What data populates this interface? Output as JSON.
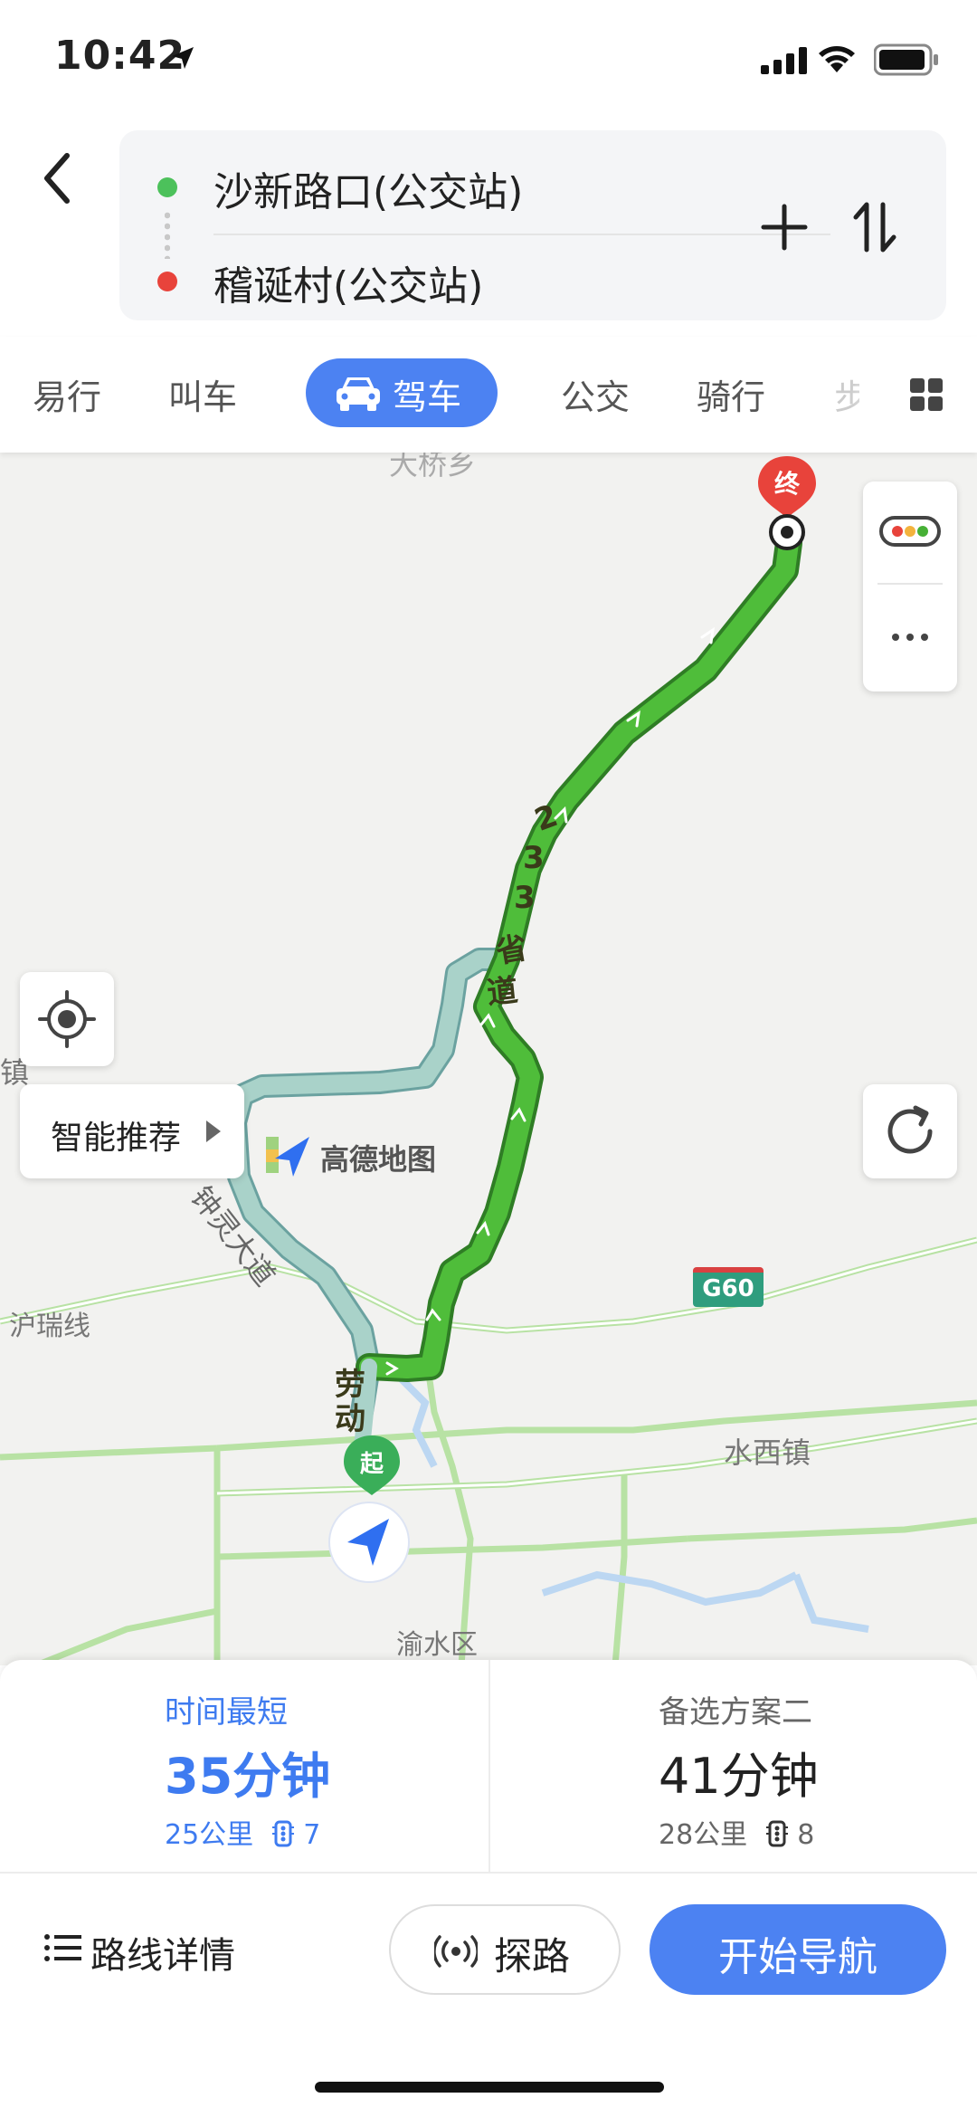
{
  "status_bar": {
    "time": "10:42"
  },
  "route": {
    "start": "沙新路口(公交站)",
    "end": "稽诞村(公交站)"
  },
  "tabs": {
    "easy": "易行",
    "taxi": "叫车",
    "drive": "驾车",
    "bus": "公交",
    "bike": "骑行",
    "walk": "步"
  },
  "map": {
    "labels": {
      "town_left": "镇",
      "hurui_line": "沪瑞线",
      "shuixi_town": "水西镇",
      "yushui_district": "渝水区",
      "top_partial": "大桥乡"
    },
    "road_labels": {
      "provincial_1": "2",
      "provincial_2": "3",
      "provincial_3": "3",
      "provincial_4": "省",
      "provincial_5": "道",
      "zhongling": "钟灵大道",
      "laodong_1": "劳",
      "laodong_2": "动"
    },
    "highway_shield": "G60",
    "pin_end": "终",
    "pin_start": "起",
    "smart_recommend": "智能推荐",
    "brand": "高德地图"
  },
  "routes": [
    {
      "tag": "时间最短",
      "time": "35分钟",
      "distance": "25公里",
      "lights": "7"
    },
    {
      "tag": "备选方案二",
      "time": "41分钟",
      "distance": "28公里",
      "lights": "8"
    }
  ],
  "actions": {
    "details": "路线详情",
    "probe": "探路",
    "navigate": "开始导航"
  },
  "colors": {
    "accent": "#4c82f2",
    "route_main": "#46b035",
    "route_alt": "#a8d3c8",
    "start_dot": "#4cc15b",
    "end_dot": "#e8433b"
  }
}
